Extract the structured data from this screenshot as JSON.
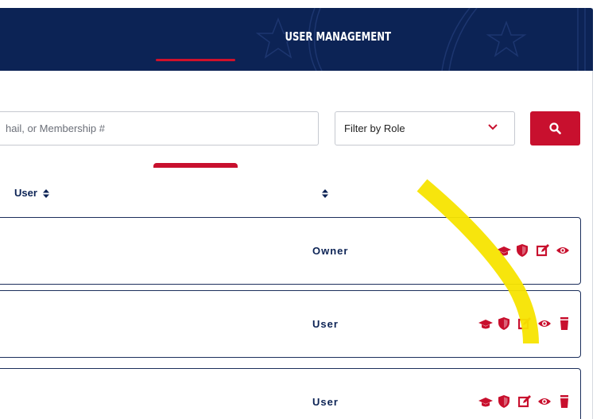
{
  "header": {
    "title": "USER MANAGEMENT"
  },
  "search": {
    "placeholder": "hail, or Membership #",
    "role_filter": "Filter by Role"
  },
  "table": {
    "columns": [
      "User",
      ""
    ],
    "rows": [
      {
        "role": "Owner",
        "actions": [
          "graduation-cap-icon",
          "shield-icon",
          "edit-icon",
          "eye-icon"
        ]
      },
      {
        "role": "User",
        "actions": [
          "graduation-cap-icon",
          "shield-icon",
          "edit-icon",
          "eye-icon",
          "trash-icon"
        ]
      },
      {
        "role": "User",
        "actions": [
          "graduation-cap-icon",
          "shield-icon",
          "edit-icon",
          "eye-icon",
          "trash-icon"
        ]
      }
    ]
  },
  "colors": {
    "navy": "#0c2355",
    "accent_red": "#c8102e",
    "highlight": "#f7e400"
  }
}
